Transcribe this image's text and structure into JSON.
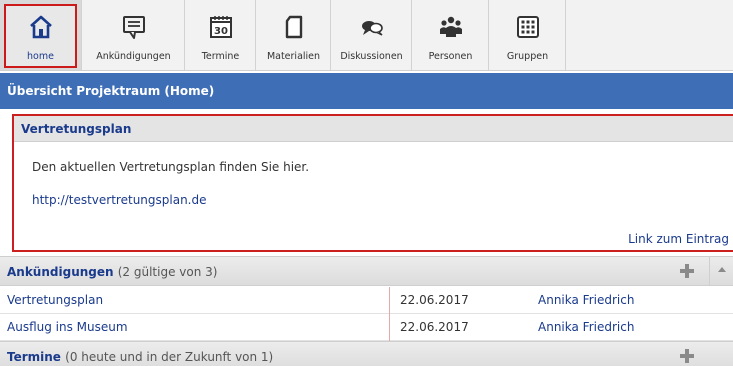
{
  "toolbar": {
    "items": [
      {
        "label": "home",
        "icon": "home-icon",
        "active": true
      },
      {
        "label": "Ankündigungen",
        "icon": "speech-bubble-icon",
        "active": false
      },
      {
        "label": "Termine",
        "icon": "calendar-icon",
        "calendar_day": "30",
        "active": false
      },
      {
        "label": "Materialien",
        "icon": "document-icon",
        "active": false
      },
      {
        "label": "Diskussionen",
        "icon": "discussion-icon",
        "active": false
      },
      {
        "label": "Personen",
        "icon": "people-icon",
        "active": false
      },
      {
        "label": "Gruppen",
        "icon": "grid-icon",
        "active": false
      }
    ]
  },
  "page_title": "Übersicht Projektraum (Home)",
  "vertretungsplan": {
    "title": "Vertretungsplan",
    "text": "Den aktuellen Vertretungsplan finden Sie hier.",
    "link": "http://testvertretungsplan.de",
    "more_link": "Link zum Eintrag"
  },
  "announcements": {
    "title": "Ankündigungen",
    "count": "(2 gültige von 3)",
    "rows": [
      {
        "title": "Vertretungsplan",
        "date": "22.06.2017",
        "author": "Annika Friedrich"
      },
      {
        "title": "Ausflug ins Museum",
        "date": "22.06.2017",
        "author": "Annika Friedrich"
      }
    ]
  },
  "appointments": {
    "title": "Termine",
    "count": "(0 heute und in der Zukunft von 1)"
  },
  "colors": {
    "header_blue": "#3e6eb6",
    "link_blue": "#1a3a8c",
    "highlight_red": "#cc2020"
  }
}
